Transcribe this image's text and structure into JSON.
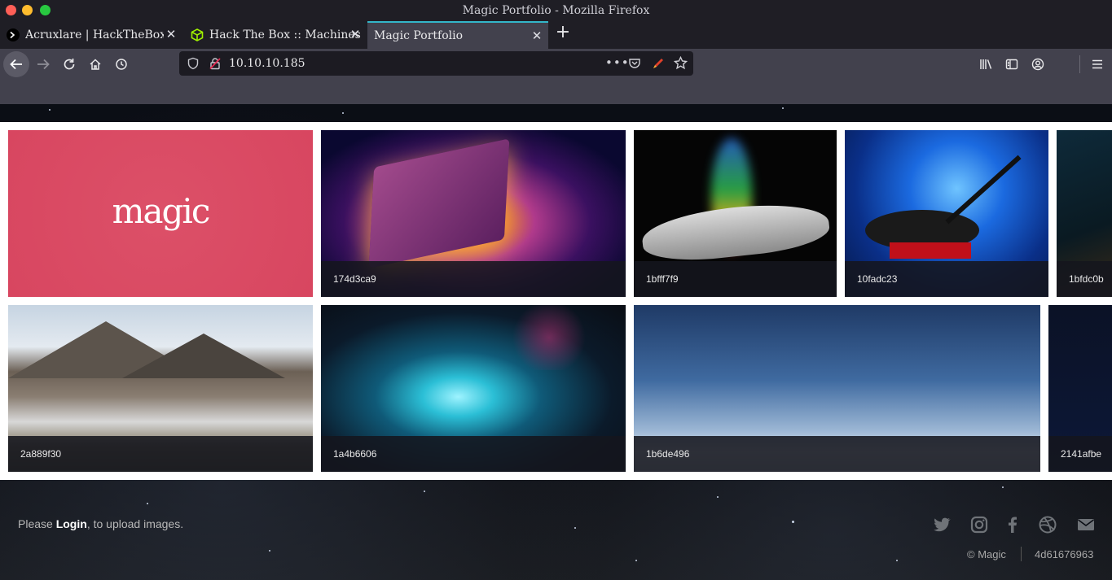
{
  "window": {
    "title": "Magic Portfolio - Mozilla Firefox"
  },
  "tabs": [
    {
      "label": "Acruxlare | HackTheBox - ",
      "active": false
    },
    {
      "label": "Hack The Box :: Machines",
      "active": false
    },
    {
      "label": "Magic Portfolio",
      "active": true
    }
  ],
  "navbar": {
    "url": "10.10.10.185"
  },
  "gallery": {
    "row1": [
      {
        "caption": ""
      },
      {
        "caption": "174d3ca9"
      },
      {
        "caption": "1bfff7f9"
      },
      {
        "caption": "10fadc23"
      },
      {
        "caption": "1bfdc0b"
      }
    ],
    "row2": [
      {
        "caption": "2a889f30"
      },
      {
        "caption": "1a4b6606"
      },
      {
        "caption": "1b6de496"
      },
      {
        "caption": "2141afbe"
      }
    ],
    "logo_text": "magic"
  },
  "footer": {
    "prefix": "Please ",
    "login_label": "Login",
    "suffix": ", to upload images.",
    "copyright": "© Magic",
    "hash": "4d61676963"
  },
  "icons": [
    "twitter-icon",
    "instagram-icon",
    "facebook-icon",
    "dribbble-icon",
    "mail-icon"
  ]
}
